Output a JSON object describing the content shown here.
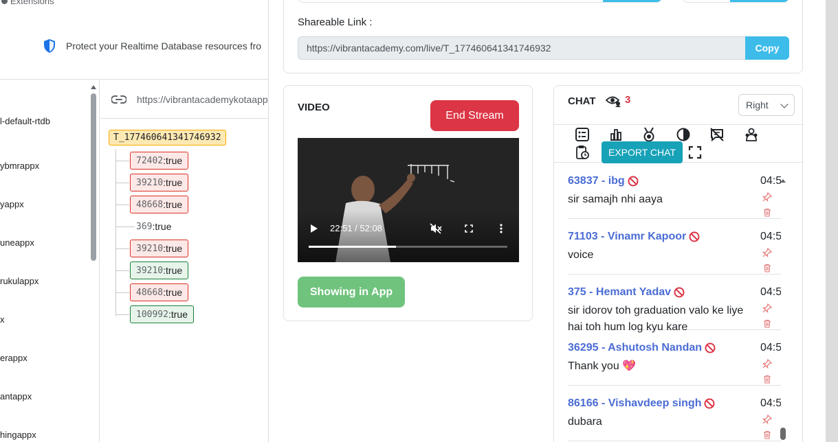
{
  "background": {
    "extensions_label": "Extensions",
    "protect_text": "Protect your Realtime Database resources fro",
    "database_list": [
      "l-default-rtdb",
      "ybmrappx",
      "yappx",
      "uneappx",
      "rukulappx",
      "x",
      "erappx",
      "antappx",
      "hingappx"
    ],
    "url": "https://vibrantacademykotaapp",
    "root_key": "T_177460641341746932",
    "nodes": [
      {
        "key": "72402",
        "value": "true",
        "state": "red"
      },
      {
        "key": "39210",
        "value": "true",
        "state": "red"
      },
      {
        "key": "48668",
        "value": "true",
        "state": "red"
      },
      {
        "key": "369",
        "value": "true",
        "state": "plain"
      },
      {
        "key": "39210",
        "value": "true",
        "state": "red"
      },
      {
        "key": "39210",
        "value": "true",
        "state": "green"
      },
      {
        "key": "48668",
        "value": "true",
        "state": "red"
      },
      {
        "key": "100992",
        "value": "true",
        "state": "green"
      }
    ]
  },
  "share": {
    "label": "Shareable Link :",
    "link": "https://vibrantacademy.com/live/T_177460641341746932",
    "copy_label": "Copy"
  },
  "video": {
    "title": "VIDEO",
    "end_label": "End Stream",
    "time": "22:51 / 52:08",
    "progress_fraction": 0.438,
    "show_label": "Showing in App"
  },
  "chat": {
    "title": "CHAT",
    "viewer_count": "3",
    "side_value": "Right",
    "export_label": "EXPORT CHAT",
    "messages": [
      {
        "user": "63837 - ibg",
        "text": "sir samajh nhi aaya",
        "time": "04:5"
      },
      {
        "user": "71103 - Vinamr Kapoor",
        "text": "voice",
        "time": "04:5"
      },
      {
        "user": "375 - Hemant Yadav",
        "text": "sir idorov toh graduation valo ke liye hai toh hum log kyu kare",
        "time": "04:5"
      },
      {
        "user": "36295 - Ashutosh Nandan",
        "text": "Thank you 💖",
        "time": "04:5"
      },
      {
        "user": "86166 - Vishavdeep singh",
        "text": "dubara",
        "time": "04:5"
      }
    ]
  },
  "colors": {
    "accent_blue": "#3dbce9",
    "danger": "#dc3545",
    "success": "#6fc37d",
    "info": "#17a2b8",
    "user_name": "#4a6cd4"
  }
}
